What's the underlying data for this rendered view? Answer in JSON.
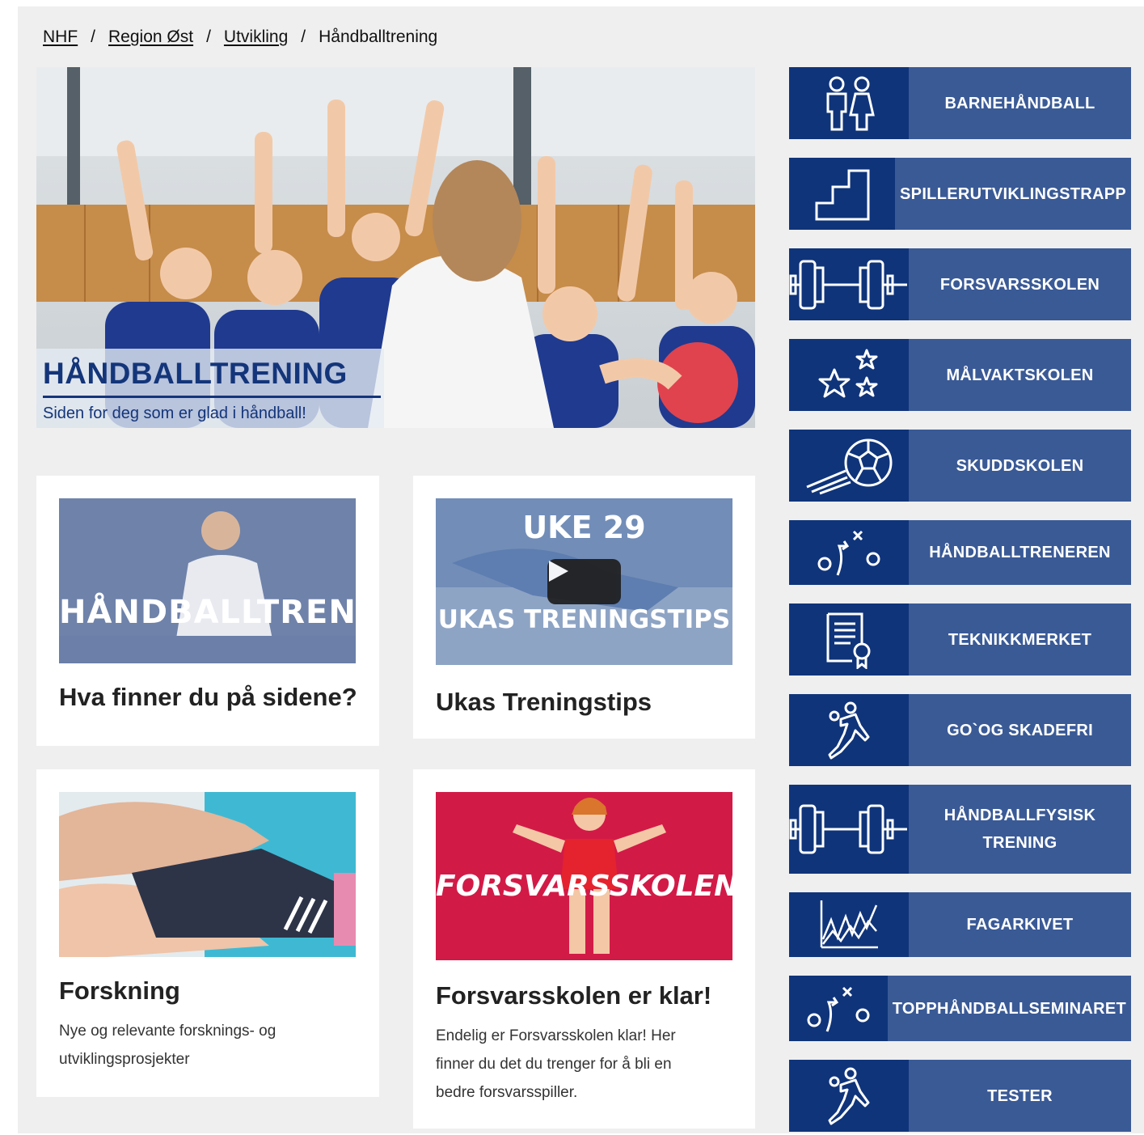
{
  "breadcrumb": {
    "items": [
      "NHF",
      "Region Øst",
      "Utvikling"
    ],
    "current": "Håndballtrening",
    "separator": "/"
  },
  "hero": {
    "title": "HÅNDBALLTRENING",
    "subtitle": "Siden for deg som er glad i håndball!"
  },
  "cards": [
    {
      "image_text": "HÅNDBALLTRENING",
      "title": "Hva finner du på sidene?",
      "text": ""
    },
    {
      "image_text_top": "UKE 29",
      "image_text_bottom": "UKAS TRENINGSTIPS",
      "icon": "play-icon",
      "title": "Ukas Treningstips",
      "text": ""
    },
    {
      "title": "Forskning",
      "text": "Nye og relevante forsknings- og utviklingsprosjekter"
    },
    {
      "image_text": "FORSVARSSKOLEN",
      "title": "Forsvarsskolen er klar!",
      "text": "Endelig er Forsvarsskolen klar! Her finner du det du trenger for å bli en bedre forsvarsspiller."
    }
  ],
  "sidebar": {
    "items": [
      {
        "label": "BARNEHÅNDBALL",
        "icon": "children-icon"
      },
      {
        "label": "SPILLERUTVIKLINGSTRAPP",
        "icon": "stairs-icon"
      },
      {
        "label": "FORSVARSSKOLEN",
        "icon": "dumbbell-icon"
      },
      {
        "label": "MÅLVAKTSKOLEN",
        "icon": "stars-icon"
      },
      {
        "label": "SKUDDSKOLEN",
        "icon": "ball-icon"
      },
      {
        "label": "HÅNDBALLTRENEREN",
        "icon": "tactics-icon"
      },
      {
        "label": "TEKNIKKMERKET",
        "icon": "certificate-icon"
      },
      {
        "label": "GO`OG SKADEFRI",
        "icon": "player-icon"
      },
      {
        "label": "HÅNDBALLFYSISK TRENING",
        "icon": "dumbbell-icon"
      },
      {
        "label": "FAGARKIVET",
        "icon": "chart-icon"
      },
      {
        "label": "TOPPHÅNDBALLSEMINARET",
        "icon": "tactics-icon"
      },
      {
        "label": "TESTER",
        "icon": "player-icon"
      }
    ]
  },
  "colors": {
    "navy": "#0f347a",
    "blue": "#3a5a96",
    "background": "#efefef",
    "hero_title": "#13357a",
    "forsvar_red": "#d21a47"
  }
}
